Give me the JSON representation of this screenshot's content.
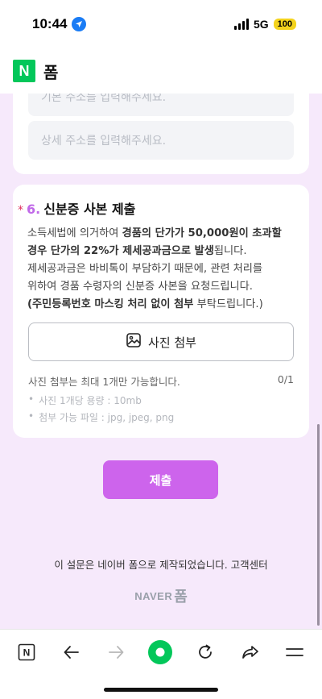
{
  "status_bar": {
    "time": "10:44",
    "network": "5G",
    "battery": "100"
  },
  "header": {
    "logo": "N",
    "title": "폼"
  },
  "address": {
    "base_placeholder": "기본 주소를 입력해주세요.",
    "detail_placeholder": "상세 주소를 입력해주세요."
  },
  "question": {
    "required_mark": "*",
    "number": "6.",
    "title": "신분증 사본 제출",
    "desc": [
      [
        {
          "t": "소득세법에 의거하여 ",
          "b": false
        },
        {
          "t": "경품의 단가가 50,000원이 초과할",
          "b": true
        }
      ],
      [
        {
          "t": "경우 단가의 22%가 제세공과금으로 발생",
          "b": true
        },
        {
          "t": "됩니다.",
          "b": false
        }
      ],
      [
        {
          "t": "제세공과금은 바비톡이 부담하기 때문에, 관련 처리를",
          "b": false
        }
      ],
      [
        {
          "t": "위하여 경품 수령자의 신분증 사본을 요청드립니다.",
          "b": false
        }
      ],
      [
        {
          "t": "(주민등록번호 마스킹 처리 없이 첨부",
          "b": true
        },
        {
          "t": " 부탁드립니다.)",
          "b": false
        }
      ]
    ],
    "attach_label": "사진 첨부",
    "attach_note": "사진 첨부는 최대 1개만 가능합니다.",
    "attach_count": "0/1",
    "rules": [
      "사진 1개당 용량 : 10mb",
      "첨부 가능 파일 : jpg, jpeg, png"
    ],
    "bullet": "•"
  },
  "submit_label": "제출",
  "footer": {
    "note": "이 설문은 네이버 폼으로 제작되었습니다. 고객센터",
    "brand_naver": "NAVER",
    "brand_form": "폼"
  },
  "toolbar": {
    "icons": [
      "naver-n-icon",
      "back-arrow-icon",
      "forward-arrow-icon",
      "green-dot-icon",
      "reload-icon",
      "share-icon",
      "menu-icon"
    ],
    "home_label": "N",
    "accent": "#03c75a"
  },
  "colors": {
    "accent_purple": "#cd64ec",
    "background": "#f6e9fb",
    "required_red": "#e0325f"
  }
}
